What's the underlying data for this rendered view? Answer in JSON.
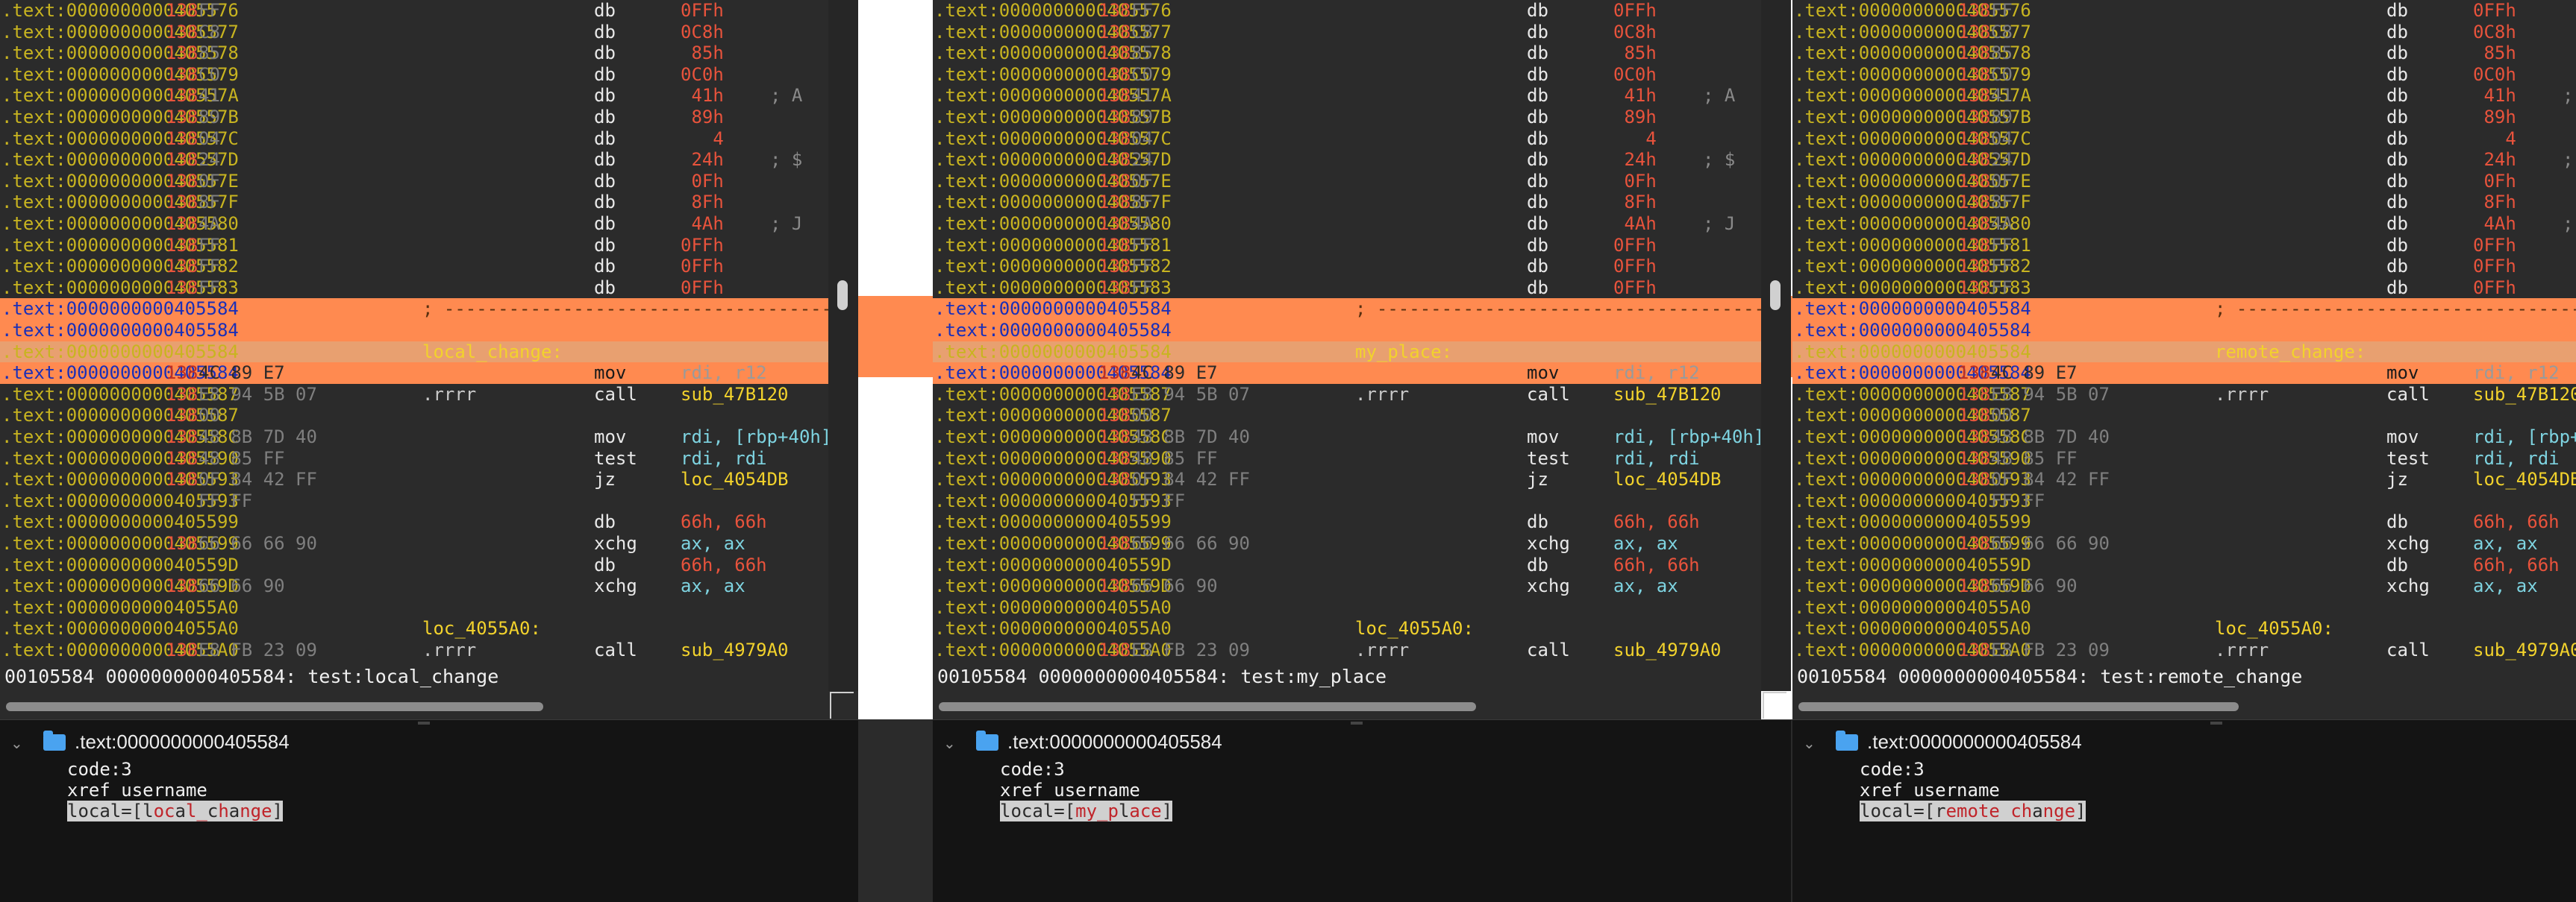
{
  "listing_rows": [
    {
      "addr": ".text:0000000000405576",
      "n": "138",
      "hex": "FF",
      "mn": "db",
      "op": "0FFh",
      "cmt": ""
    },
    {
      "addr": ".text:0000000000405577",
      "n": "138",
      "hex": "C8",
      "mn": "db",
      "op": "0C8h",
      "cmt": ""
    },
    {
      "addr": ".text:0000000000405578",
      "n": "138",
      "hex": "85",
      "mn": "db",
      "op": " 85h",
      "cmt": ""
    },
    {
      "addr": ".text:0000000000405579",
      "n": "138",
      "hex": "C0",
      "mn": "db",
      "op": "0C0h",
      "cmt": ""
    },
    {
      "addr": ".text:000000000040557A",
      "n": "138",
      "hex": "41",
      "mn": "db",
      "op": " 41h",
      "cmt": "; A"
    },
    {
      "addr": ".text:000000000040557B",
      "n": "138",
      "hex": "89",
      "mn": "db",
      "op": " 89h",
      "cmt": ""
    },
    {
      "addr": ".text:000000000040557C",
      "n": "138",
      "hex": "04",
      "mn": "db",
      "op": "   4",
      "cmt": ""
    },
    {
      "addr": ".text:000000000040557D",
      "n": "138",
      "hex": "24",
      "mn": "db",
      "op": " 24h",
      "cmt": "; $"
    },
    {
      "addr": ".text:000000000040557E",
      "n": "138",
      "hex": "0F",
      "mn": "db",
      "op": " 0Fh",
      "cmt": ""
    },
    {
      "addr": ".text:000000000040557F",
      "n": "138",
      "hex": "8F",
      "mn": "db",
      "op": " 8Fh",
      "cmt": ""
    },
    {
      "addr": ".text:0000000000405580",
      "n": "138",
      "hex": "4A",
      "mn": "db",
      "op": " 4Ah",
      "cmt": "; J"
    },
    {
      "addr": ".text:0000000000405581",
      "n": "138",
      "hex": "FF",
      "mn": "db",
      "op": "0FFh",
      "cmt": ""
    },
    {
      "addr": ".text:0000000000405582",
      "n": "138",
      "hex": "FF",
      "mn": "db",
      "op": "0FFh",
      "cmt": ""
    },
    {
      "addr": ".text:0000000000405583",
      "n": "138",
      "hex": "FF",
      "mn": "db",
      "op": "0FFh",
      "cmt": ""
    }
  ],
  "highlight": {
    "addr": ".text:0000000000405584",
    "separator": "; ------------------------------------------------",
    "mov_hex": "4C 89 E7",
    "mov_mn": "mov",
    "mov_ops": "rdi, r12"
  },
  "after_rows": [
    {
      "addr": ".text:0000000000405587",
      "n": "138",
      "hex": "E8 94 5B 07",
      "rrrr": ".rrrr",
      "mn": "call",
      "op": "sub_47B120",
      "type": "sub"
    },
    {
      "addr": ".text:0000000000405587",
      "n": "138",
      "hex": "00",
      "rrrr": "",
      "mn": "",
      "op": "",
      "type": ""
    },
    {
      "addr": ".text:000000000040558C",
      "n": "138",
      "hex": "48 8B 7D 40",
      "rrrr": "",
      "mn": "mov",
      "op": "rdi, [rbp+40h]",
      "type": "reg"
    },
    {
      "addr": ".text:0000000000405590",
      "n": "138",
      "hex": "48 85 FF",
      "rrrr": "",
      "mn": "test",
      "op": "rdi, rdi",
      "type": "reg"
    },
    {
      "addr": ".text:0000000000405593",
      "n": "138",
      "hex": "0F 84 42 FF",
      "rrrr": "",
      "mn": "jz",
      "op": "loc_4054DB",
      "type": "sub"
    },
    {
      "addr": ".text:0000000000405593",
      "n": "",
      "hex": "FF FF",
      "rrrr": "",
      "mn": "",
      "op": "",
      "type": ""
    },
    {
      "addr": ".text:0000000000405599",
      "n": "",
      "hex": "",
      "rrrr": "",
      "mn": "db",
      "op": "66h, 66h",
      "type": ""
    },
    {
      "addr": ".text:0000000000405599",
      "n": "138",
      "hex": "66 66 66 90",
      "rrrr": "",
      "mn": "xchg",
      "op": "ax, ax",
      "type": "reg"
    },
    {
      "addr": ".text:000000000040559D",
      "n": "",
      "hex": "",
      "rrrr": "",
      "mn": "db",
      "op": "66h, 66h",
      "type": ""
    },
    {
      "addr": ".text:000000000040559D",
      "n": "138",
      "hex": "66 66 90",
      "rrrr": "",
      "mn": "xchg",
      "op": "ax, ax",
      "type": "reg"
    },
    {
      "addr": ".text:00000000004055A0",
      "n": "",
      "hex": "",
      "rrrr": "",
      "mn": "",
      "op": "",
      "type": ""
    },
    {
      "addr": ".text:00000000004055A0",
      "n": "",
      "hex": "",
      "rrrr": "loc_4055A0:",
      "mn": "",
      "op": "",
      "type": "label"
    },
    {
      "addr": ".text:00000000004055A0",
      "n": "138",
      "hex": "E8 FB 23 09",
      "rrrr": ".rrrr",
      "mn": "call",
      "op": "sub_4979A0",
      "type": "sub"
    },
    {
      "addr": ".text:00000000004055A0",
      "n": "",
      "hex": "",
      "rrrr": "",
      "mn": "",
      "op": "",
      "type": ""
    }
  ],
  "panels": [
    {
      "label": "local_change:",
      "status": "00105584 0000000000405584: test:local_change",
      "tree_title": ".text:0000000000405584",
      "code": "code:3",
      "xref": "xref username",
      "local_prefix": "local=[",
      "local_parts": [
        [
          "l",
          0
        ],
        [
          "oc",
          1
        ],
        [
          "a",
          0
        ],
        [
          "l_",
          1
        ],
        [
          "c",
          0
        ],
        [
          "h",
          1
        ],
        [
          "a",
          0
        ],
        [
          "nge",
          1
        ],
        [
          "]",
          0
        ]
      ]
    },
    {
      "label": "my_place:",
      "status": "00105584 0000000000405584: test:my_place",
      "tree_title": ".text:0000000000405584",
      "code": "code:3",
      "xref": "xref username",
      "local_prefix": "local=[",
      "local_parts": [
        [
          "my_p",
          1
        ],
        [
          "l",
          0
        ],
        [
          "ace",
          1
        ],
        [
          "]",
          0
        ]
      ]
    },
    {
      "label": "remote_change:",
      "status": "00105584 0000000000405584: test:remote_change",
      "tree_title": ".text:0000000000405584",
      "code": "code:3",
      "xref": "xref username",
      "local_prefix": "local=[",
      "local_parts": [
        [
          "r",
          0
        ],
        [
          "emote",
          1
        ],
        [
          " ",
          0
        ],
        [
          "ch",
          1
        ],
        [
          "a",
          0
        ],
        [
          "nge",
          1
        ],
        [
          "]",
          0
        ]
      ]
    }
  ]
}
